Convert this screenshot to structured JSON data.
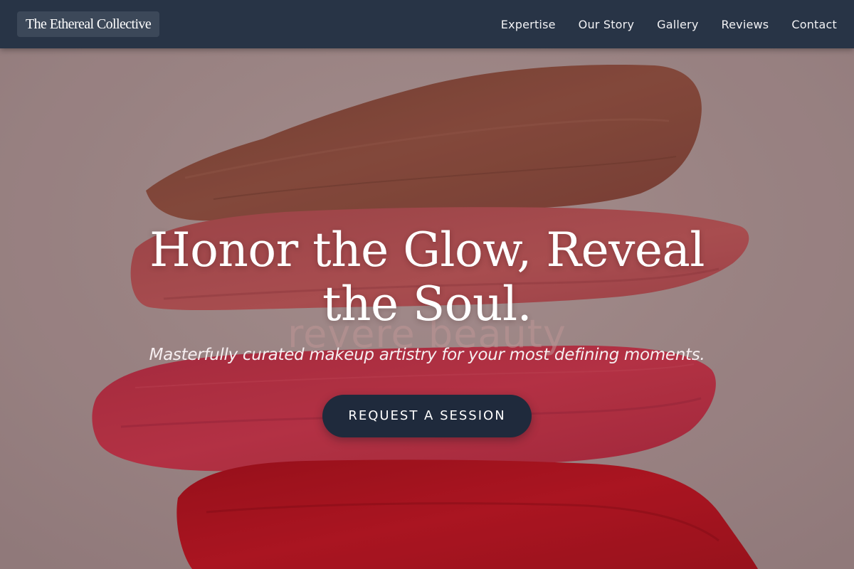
{
  "nav": {
    "brand": "The Ethereal Collective",
    "links": [
      {
        "label": "Expertise"
      },
      {
        "label": "Our Story"
      },
      {
        "label": "Gallery"
      },
      {
        "label": "Reviews"
      },
      {
        "label": "Contact"
      }
    ]
  },
  "hero": {
    "watermark": "revere beauty",
    "title": "Honor the Glow, Reveal the Soul.",
    "subtitle": "Masterfully curated makeup artistry for your most defining moments.",
    "cta_label": "REQUEST A SESSION",
    "background_image": "makeup-swatches-image"
  },
  "colors": {
    "nav_bg": "#283446",
    "brand_chip_bg": "#3c4859",
    "cta_bg": "#1f2a3c",
    "page_bg": "#a8908f",
    "swatch_bronze": "#8a4a3c",
    "swatch_rose": "#b84f52",
    "swatch_pink_red": "#c02a40",
    "swatch_red": "#b4101e"
  }
}
